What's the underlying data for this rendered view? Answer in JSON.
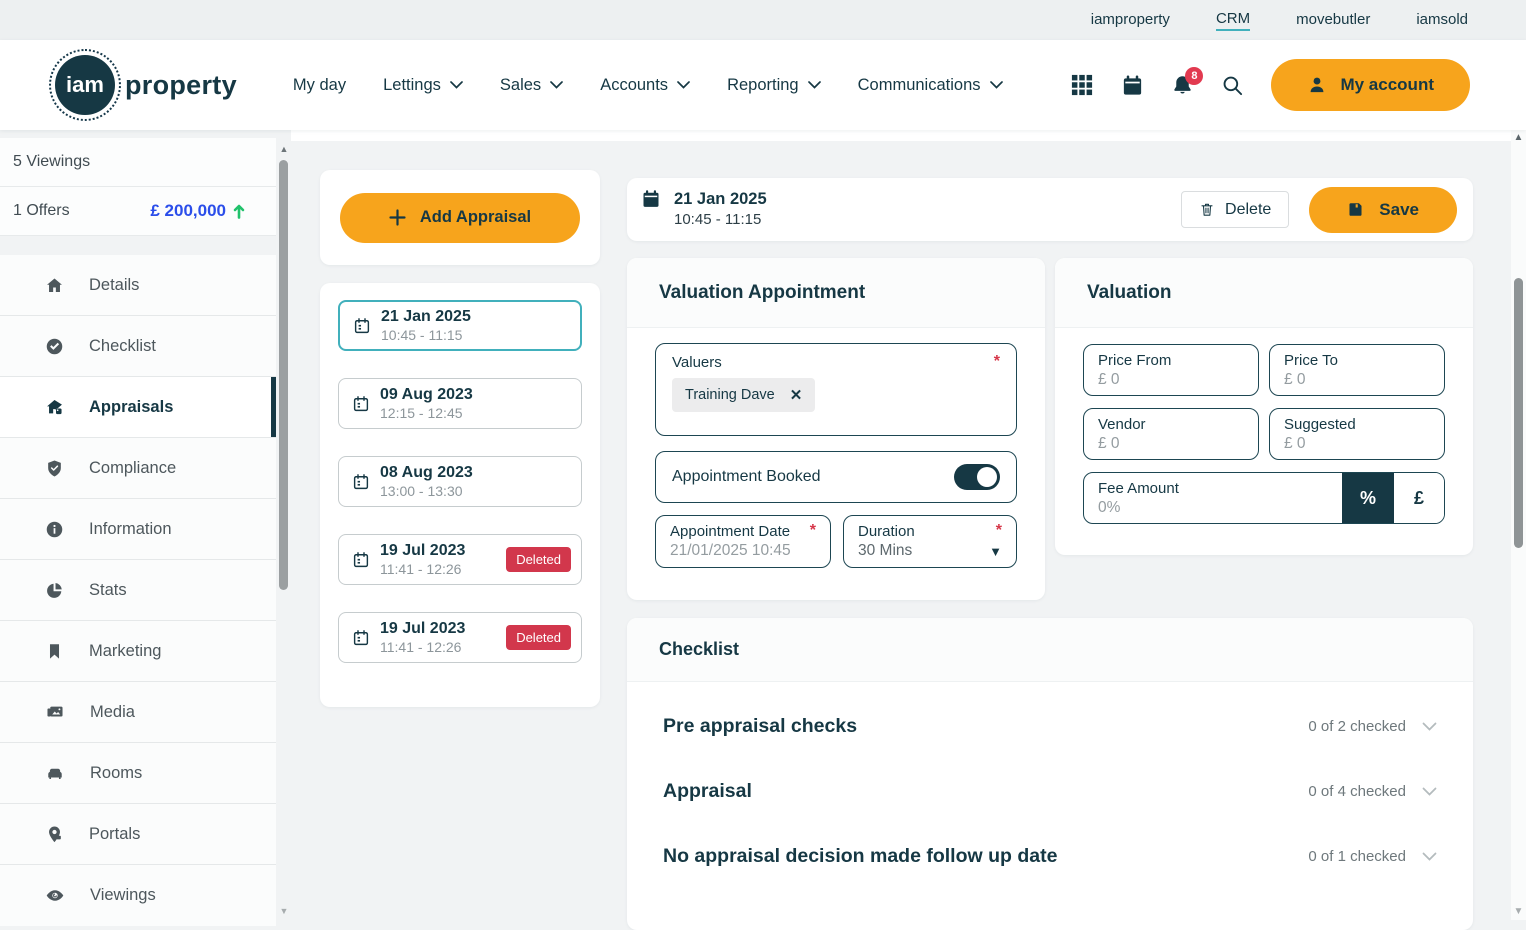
{
  "colors": {
    "accent_orange": "#F7A41C",
    "teal": "#41B0BC",
    "navy": "#163844",
    "alert_red": "#D2374C",
    "offer_blue": "#2B4EEA",
    "positive_green": "#21C26B"
  },
  "top_bar": {
    "links": [
      {
        "label": "iamproperty",
        "active": false
      },
      {
        "label": "CRM",
        "active": true
      },
      {
        "label": "movebutler",
        "active": false
      },
      {
        "label": "iamsold",
        "active": false
      }
    ]
  },
  "header": {
    "logo": {
      "circle": "iam",
      "word": "property"
    },
    "nav": [
      {
        "label": "My day"
      },
      {
        "label": "Lettings"
      },
      {
        "label": "Sales"
      },
      {
        "label": "Accounts"
      },
      {
        "label": "Reporting"
      },
      {
        "label": "Communications"
      }
    ],
    "notification_badge": "8",
    "account_button": "My account"
  },
  "sidebar": {
    "summary": {
      "viewings": "5 Viewings",
      "offers": "1 Offers",
      "offer_value": "£ 200,000"
    },
    "items": [
      {
        "label": "Details"
      },
      {
        "label": "Checklist"
      },
      {
        "label": "Appraisals",
        "active": true
      },
      {
        "label": "Compliance"
      },
      {
        "label": "Information"
      },
      {
        "label": "Stats"
      },
      {
        "label": "Marketing"
      },
      {
        "label": "Media"
      },
      {
        "label": "Rooms"
      },
      {
        "label": "Portals"
      },
      {
        "label": "Viewings"
      }
    ]
  },
  "appraisals": {
    "add_button": "Add Appraisal",
    "list": [
      {
        "date": "21 Jan 2025",
        "time": "10:45 - 11:15",
        "selected": true
      },
      {
        "date": "09 Aug 2023",
        "time": "12:15 - 12:45"
      },
      {
        "date": "08 Aug 2023",
        "time": "13:00 - 13:30"
      },
      {
        "date": "19 Jul 2023",
        "time": "11:41 - 12:26",
        "badge": "Deleted"
      },
      {
        "date": "19 Jul 2023",
        "time": "11:41 - 12:26",
        "badge": "Deleted"
      }
    ]
  },
  "detail": {
    "header": {
      "date": "21 Jan 2025",
      "time": "10:45 - 11:15",
      "delete_button": "Delete",
      "save_button": "Save"
    },
    "valuation_appointment": {
      "title": "Valuation Appointment",
      "valuers": {
        "label": "Valuers",
        "required": "*",
        "chip": "Training Dave",
        "remove": "✕"
      },
      "booked": {
        "label": "Appointment Booked",
        "on": true
      },
      "date": {
        "label": "Appointment Date",
        "required": "*",
        "value": "21/01/2025 10:45"
      },
      "duration": {
        "label": "Duration",
        "required": "*",
        "value": "30 Mins",
        "caret": "▼"
      }
    },
    "valuation": {
      "title": "Valuation",
      "price_from": {
        "label": "Price From",
        "value": "£ 0"
      },
      "price_to": {
        "label": "Price To",
        "value": "£ 0"
      },
      "vendor": {
        "label": "Vendor",
        "value": "£ 0"
      },
      "suggested": {
        "label": "Suggested",
        "value": "£ 0"
      },
      "fee": {
        "label": "Fee Amount",
        "value": "0%",
        "unit_percent": "%",
        "unit_pound": "£"
      }
    },
    "checklist": {
      "title": "Checklist",
      "rows": [
        {
          "label": "Pre appraisal checks",
          "status": "0 of 2 checked"
        },
        {
          "label": "Appraisal",
          "status": "0 of 4 checked"
        },
        {
          "label": "No appraisal decision made follow up date",
          "status": "0 of 1 checked"
        }
      ]
    }
  }
}
